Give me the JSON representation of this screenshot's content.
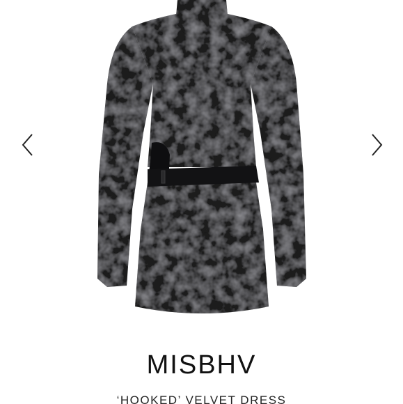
{
  "product": {
    "brand": "MISBHV",
    "name": "‘HOOKED’ VELVET DRESS",
    "image_icon": "velvet-dress-image"
  },
  "carousel": {
    "prev_icon": "chevron-left-icon",
    "next_icon": "chevron-right-icon"
  },
  "colors": {
    "background": "#ffffff",
    "dress": "#1c1c1e",
    "text": "#111111"
  }
}
